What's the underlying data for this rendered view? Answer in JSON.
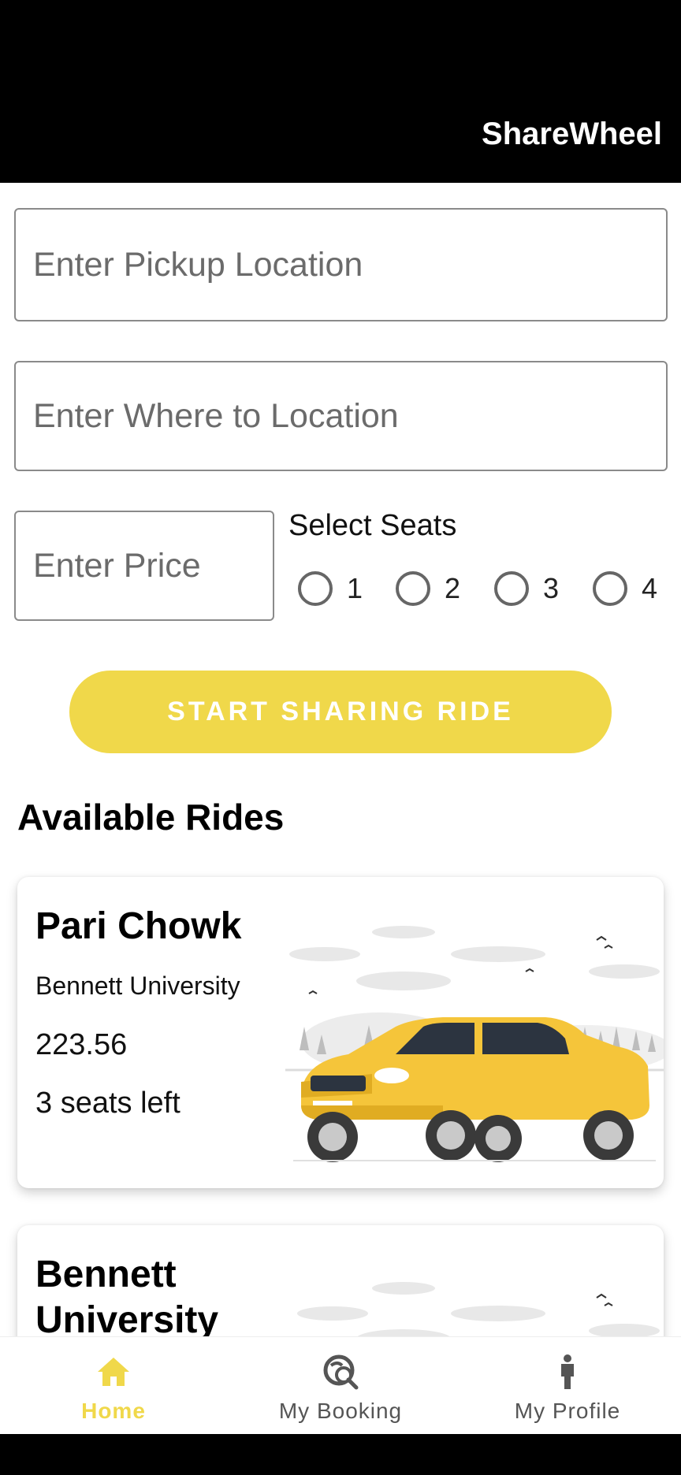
{
  "app": {
    "title": "ShareWheel"
  },
  "form": {
    "pickup_placeholder": "Enter Pickup Location",
    "whereto_placeholder": "Enter Where to Location",
    "price_placeholder": "Enter Price",
    "seats_label": "Select Seats",
    "seat_options": [
      "1",
      "2",
      "3",
      "4"
    ],
    "start_button": "START SHARING RIDE"
  },
  "rides_section": {
    "title": "Available Rides"
  },
  "rides": [
    {
      "from": "Pari Chowk",
      "to": "Bennett University",
      "price": "223.56",
      "seats": "3 seats left"
    },
    {
      "from": "Bennett University"
    }
  ],
  "nav": {
    "items": [
      {
        "label": "Home",
        "icon": "home-icon",
        "active": true
      },
      {
        "label": "My Booking",
        "icon": "booking-search-icon",
        "active": false
      },
      {
        "label": "My Profile",
        "icon": "person-icon",
        "active": false
      }
    ]
  },
  "colors": {
    "accent": "#f0d84a",
    "header": "#000000",
    "car": "#f5c53a"
  }
}
